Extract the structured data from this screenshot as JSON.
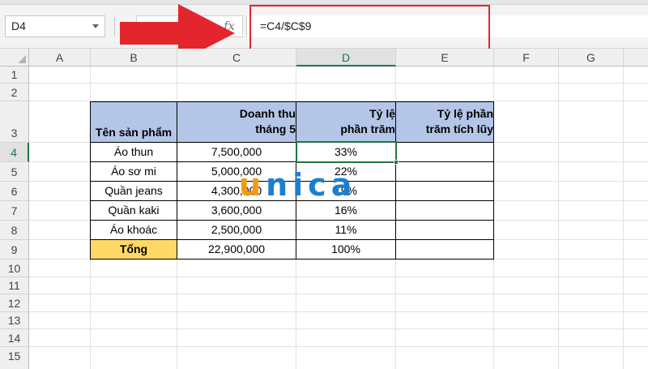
{
  "formula_bar": {
    "name_box": "D4",
    "fx_label": "fx",
    "formula": "=C4/$C$9"
  },
  "columns": [
    "A",
    "B",
    "C",
    "D",
    "E",
    "F",
    "G"
  ],
  "rows": [
    "1",
    "2",
    "3",
    "4",
    "5",
    "6",
    "7",
    "8",
    "9",
    "10",
    "11",
    "12",
    "13",
    "14",
    "15"
  ],
  "selected_column": "D",
  "selected_row": "4",
  "table": {
    "headers": [
      "Tên sản phẩm",
      "Doanh thu tháng 5",
      "Tỷ lệ phần trăm",
      "Tỷ lệ phần trăm tích lũy"
    ],
    "header_lines": [
      [
        "Tên sản phẩm"
      ],
      [
        "Doanh thu",
        "tháng 5"
      ],
      [
        "Tỷ lệ",
        "phần trăm"
      ],
      [
        "Tỷ lệ phần",
        "trăm tích lũy"
      ]
    ],
    "rows": [
      [
        "Áo thun",
        "7,500,000",
        "33%",
        ""
      ],
      [
        "Áo sơ mi",
        "5,000,000",
        "22%",
        ""
      ],
      [
        "Quần jeans",
        "4,300,000",
        "19%",
        ""
      ],
      [
        "Quần kaki",
        "3,600,000",
        "16%",
        ""
      ],
      [
        "Áo khoác",
        "2,500,000",
        "11%",
        ""
      ]
    ],
    "total": [
      "Tổng",
      "22,900,000",
      "100%",
      ""
    ]
  },
  "watermark": "unica",
  "colors": {
    "header_fill": "#b4c6e7",
    "total_fill": "#ffd966",
    "active_border": "#217346",
    "highlight_red": "#e3262d",
    "watermark_orange": "#f39c12",
    "watermark_blue": "#1a7fd1"
  }
}
